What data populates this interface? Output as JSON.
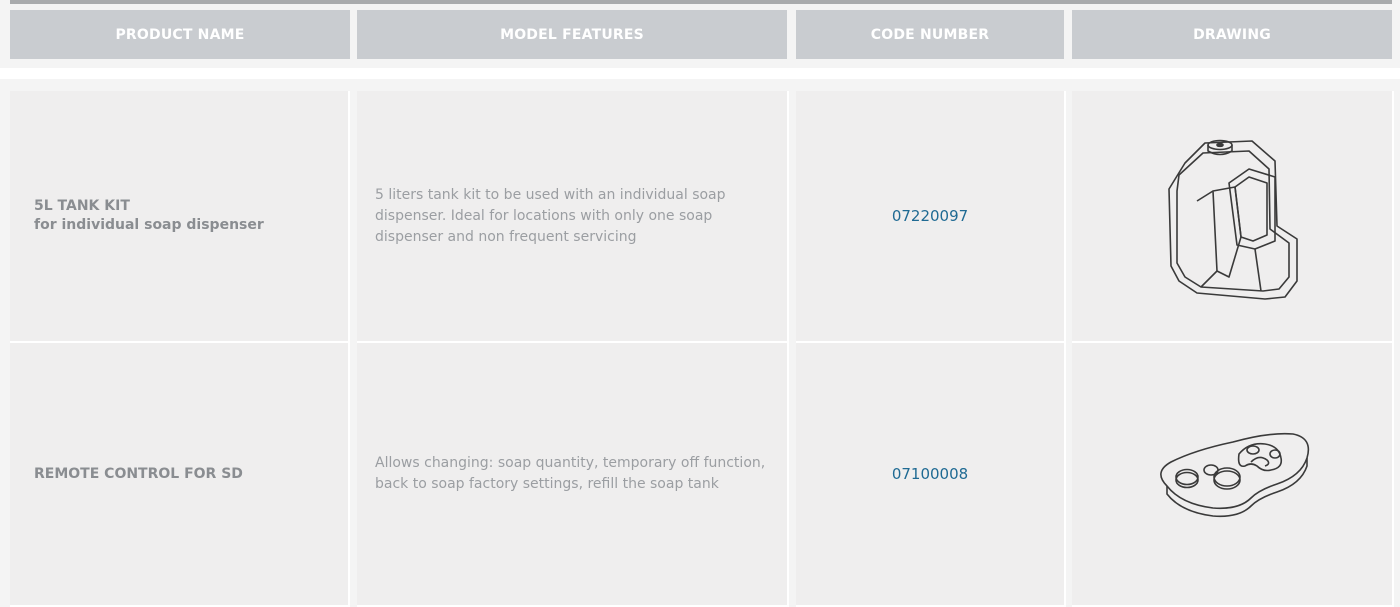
{
  "table": {
    "headers": {
      "product_name": "PRODUCT NAME",
      "model_features": "MODEL FEATURES",
      "code_number": "CODE NUMBER",
      "drawing": "DRAWING"
    },
    "rows": [
      {
        "name_line1": "5L TANK KIT",
        "name_line2": "for individual  soap dispenser",
        "features": "5 liters tank kit to be used with an individual soap dispenser. Ideal for locations with only one soap dispenser and non frequent servicing",
        "code": "07220097",
        "drawing_icon": "tank-kit-drawing-icon"
      },
      {
        "name_line1": "REMOTE CONTROL FOR SD",
        "features": "Allows changing: soap quantity, temporary off function, back to soap factory settings, refill the soap tank",
        "code": "07100008",
        "drawing_icon": "remote-control-drawing-icon"
      }
    ]
  },
  "colors": {
    "header_bg": "#c9ccd0",
    "cell_bg": "#efeeee",
    "code_link": "#1f6a93"
  }
}
